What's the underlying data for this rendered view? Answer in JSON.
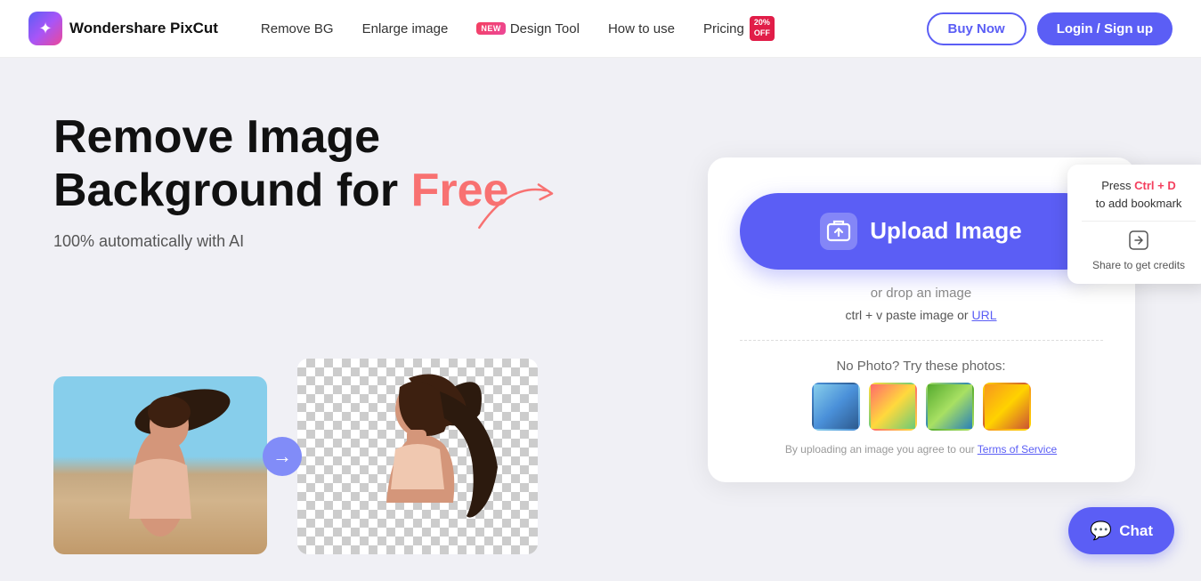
{
  "nav": {
    "logo_text": "Wondershare PixCut",
    "links": [
      {
        "id": "remove-bg",
        "label": "Remove BG"
      },
      {
        "id": "enlarge-image",
        "label": "Enlarge image"
      },
      {
        "id": "design-tool",
        "label": "Design Tool",
        "badge": "NEW"
      },
      {
        "id": "how-to-use",
        "label": "How to use"
      },
      {
        "id": "pricing",
        "label": "Pricing",
        "badge": "20% OFF"
      }
    ],
    "buy_now": "Buy Now",
    "login": "Login / Sign up"
  },
  "hero": {
    "title_line1": "Remove Image",
    "title_line2": "Background for",
    "title_free": "Free",
    "subtitle": "100% automatically with AI"
  },
  "upload_card": {
    "upload_btn_label": "Upload Image",
    "drop_text": "or drop an image",
    "paste_text": "ctrl + v paste image or",
    "paste_url_label": "URL",
    "try_photos_label": "No Photo? Try these photos:",
    "terms_prefix": "By uploading an image you agree to our",
    "terms_link": "Terms of Service"
  },
  "bookmark_popup": {
    "line1": "Press",
    "ctrl_d": "Ctrl + D",
    "line2": "to add bookmark",
    "share_label": "Share to get credits"
  },
  "chat": {
    "label": "Chat"
  }
}
